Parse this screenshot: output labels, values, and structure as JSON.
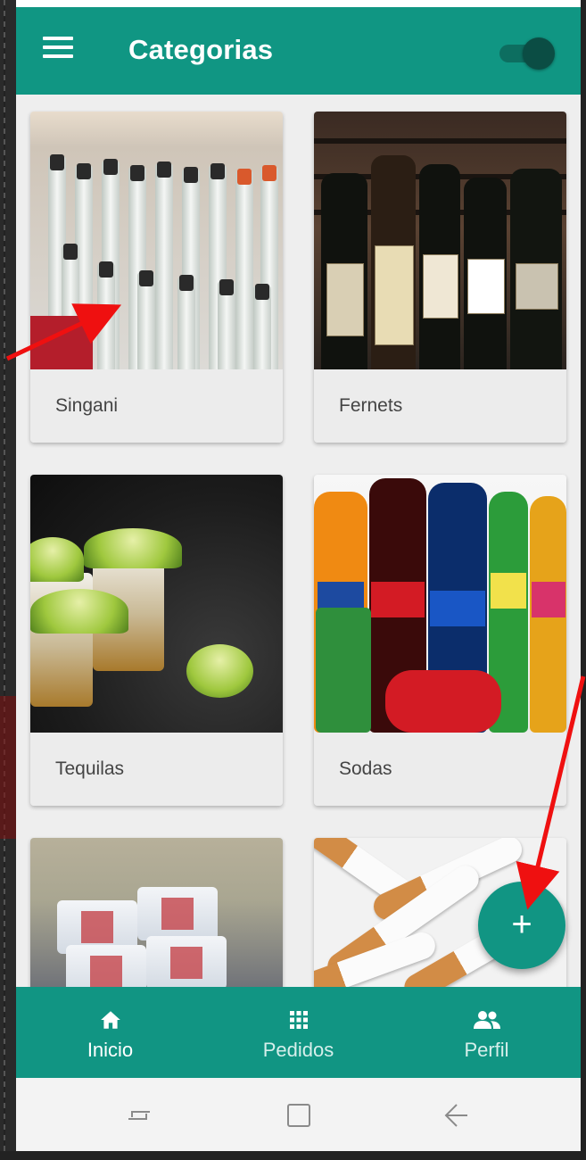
{
  "app_bar": {
    "title": "Categorias",
    "menu_icon": "hamburger-menu-icon",
    "toggle_state": "on"
  },
  "categories": [
    {
      "label": "Singani"
    },
    {
      "label": "Fernets"
    },
    {
      "label": "Tequilas"
    },
    {
      "label": "Sodas"
    },
    {
      "label": ""
    },
    {
      "label": ""
    }
  ],
  "fab": {
    "icon": "plus-icon",
    "symbol": "+"
  },
  "bottom_nav": {
    "items": [
      {
        "label": "Inicio",
        "icon": "home-icon",
        "active": true
      },
      {
        "label": "Pedidos",
        "icon": "grid-icon",
        "active": false
      },
      {
        "label": "Perfil",
        "icon": "people-icon",
        "active": false
      }
    ]
  },
  "system_nav": {
    "buttons": [
      "recents-icon",
      "home-square-icon",
      "back-icon"
    ]
  },
  "colors": {
    "primary": "#109683",
    "primary_dark": "#0b4d44",
    "background": "#eeeeee",
    "annotation_arrow": "#ef1010"
  }
}
